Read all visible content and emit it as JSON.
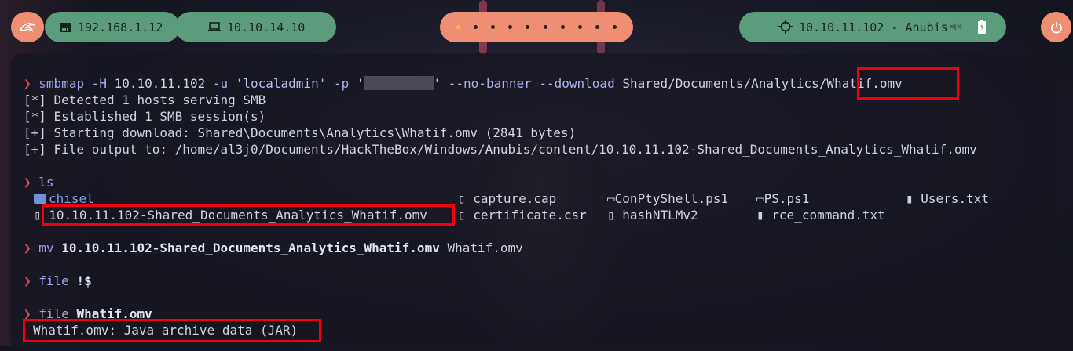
{
  "topbar": {
    "local_ip": "192.168.1.12",
    "vpn_ip": "10.10.14.10",
    "workspaces": [
      "1",
      "2",
      "3",
      "4",
      "5",
      "6",
      "7",
      "8",
      "9",
      "10"
    ],
    "active_workspace_index": 0,
    "target": "10.10.11.102 - Anubis",
    "icons": {
      "logo": "kali-dragon-icon",
      "local_ip": "ethernet-icon",
      "vpn": "laptop-icon",
      "target": "crosshair-icon",
      "mute": "muted-speaker-icon",
      "battery": "battery-icon",
      "power": "power-icon"
    }
  },
  "terminal": {
    "prompt_symbol": "❯",
    "cmd1": {
      "program": "smbmap",
      "args1": " -H ",
      "host": "10.10.11.102",
      "args2": " -u ",
      "user": "'localadmin'",
      "args3": " -p ",
      "quote_open": "'",
      "quote_close": "'",
      "args4": " --no-banner --download ",
      "path": "Shared/Documents/Analytics/",
      "file": "Whatif.omv"
    },
    "out1": [
      "[*] Detected 1 hosts serving SMB",
      "[*] Established 1 SMB session(s)",
      "[+] Starting download: Shared\\Documents\\Analytics\\Whatif.omv (2841 bytes)",
      "[+] File output to: /home/al3j0/Documents/HackTheBox/Windows/Anubis/content/10.10.11.102-Shared_Documents_Analytics_Whatif.omv"
    ],
    "cmd2": "ls",
    "ls_items": {
      "chisel": "chisel",
      "omv": "10.10.11.102-Shared_Documents_Analytics_Whatif.omv",
      "capture": "capture.cap",
      "certificate": "certificate.csr",
      "conpty": "ConPtyShell.ps1",
      "hash": "hashNTLMv2",
      "ps": "PS.ps1",
      "rce": "rce_command.txt",
      "users": "Users.txt"
    },
    "cmd3": {
      "program": "mv",
      "src": "10.10.11.102-Shared_Documents_Analytics_Whatif.omv",
      "dst": "Whatif.omv"
    },
    "cmd4": {
      "program": "file",
      "arg": "!$"
    },
    "cmd5": {
      "program": "file",
      "arg": "Whatif.omv"
    },
    "out5": "Whatif.omv: Java archive data (JAR)"
  }
}
